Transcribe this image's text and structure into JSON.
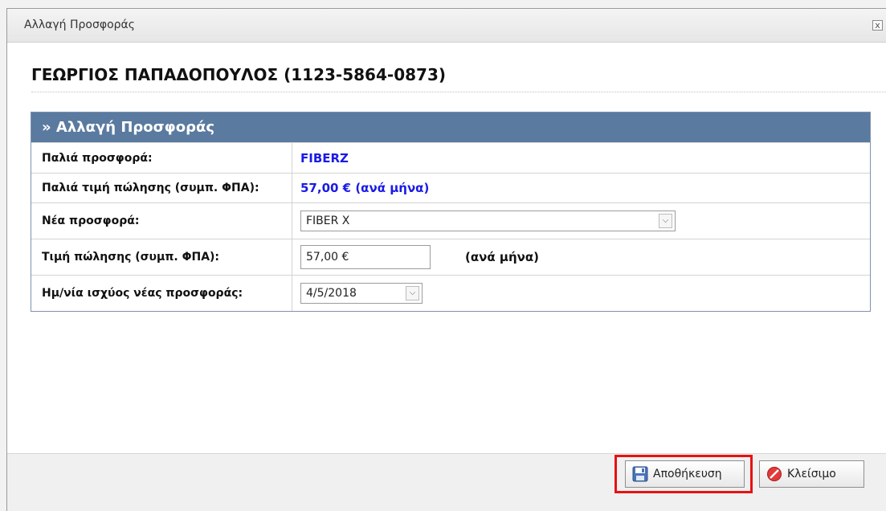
{
  "dialog": {
    "title": "Αλλαγή Προσφοράς",
    "close_label": "x"
  },
  "customer": {
    "heading": "ΓΕΩΡΓΙΟΣ ΠΑΠΑΔΟΠΟΥΛΟΣ (1123-5864-0873)"
  },
  "panel": {
    "header": "» Αλλαγή Προσφοράς",
    "rows": [
      {
        "label": "Παλιά προσφορά:",
        "value": "FIBERZ"
      },
      {
        "label": "Παλιά τιμή πώλησης (συμπ. ΦΠΑ):",
        "value": "57,00 € (ανά μήνα)"
      },
      {
        "label": "Νέα προσφορά:",
        "value": "FIBER X"
      },
      {
        "label": "Τιμή πώλησης (συμπ. ΦΠΑ):",
        "value": "57,00 €",
        "suffix": "(ανά μήνα)"
      },
      {
        "label": "Ημ/νία ισχύος νέας προσφοράς:",
        "value": "4/5/2018"
      }
    ]
  },
  "footer": {
    "save_label": "Αποθήκευση",
    "close_label": "Κλείσιμο"
  },
  "colors": {
    "panel_header": "#5a7aa0",
    "value_blue": "#1a1ae6",
    "highlight": "#e81111"
  },
  "icons": [
    "close-icon",
    "chevron-down-icon",
    "save-disk-icon",
    "close-circle-icon"
  ]
}
